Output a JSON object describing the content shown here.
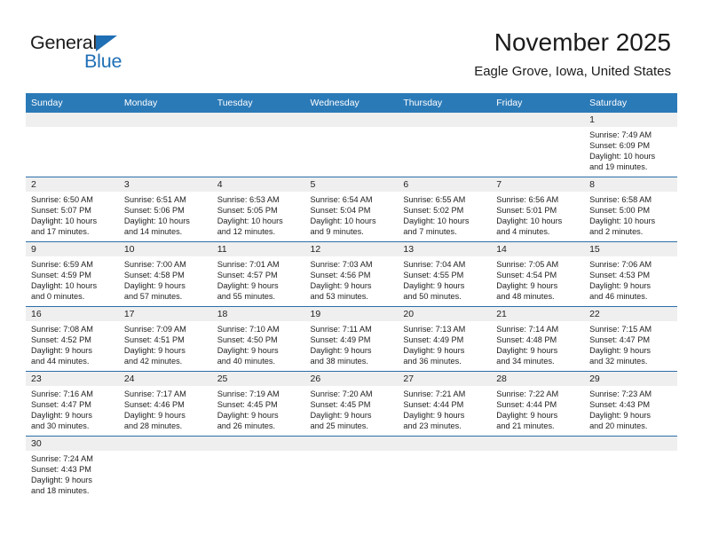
{
  "brand": {
    "name_part1": "General",
    "name_part2": "Blue",
    "accent_color": "#1f6fb5",
    "triangle_icon": "brand-triangle-icon"
  },
  "header": {
    "title": "November 2025",
    "subtitle": "Eagle Grove, Iowa, United States"
  },
  "theme": {
    "header_row_bg": "#2b7ab8",
    "daynum_band_bg": "#efefef",
    "row_divider": "#2b6ea8",
    "text": "#222222"
  },
  "columns": [
    "Sunday",
    "Monday",
    "Tuesday",
    "Wednesday",
    "Thursday",
    "Friday",
    "Saturday"
  ],
  "labels": {
    "sunrise": "Sunrise:",
    "sunset": "Sunset:",
    "daylight": "Daylight:"
  },
  "weeks": [
    [
      {
        "empty": true
      },
      {
        "empty": true
      },
      {
        "empty": true
      },
      {
        "empty": true
      },
      {
        "empty": true
      },
      {
        "empty": true
      },
      {
        "day": "1",
        "sunrise": "Sunrise: 7:49 AM",
        "sunset": "Sunset: 6:09 PM",
        "daylight_1": "Daylight: 10 hours",
        "daylight_2": "and 19 minutes."
      }
    ],
    [
      {
        "day": "2",
        "sunrise": "Sunrise: 6:50 AM",
        "sunset": "Sunset: 5:07 PM",
        "daylight_1": "Daylight: 10 hours",
        "daylight_2": "and 17 minutes."
      },
      {
        "day": "3",
        "sunrise": "Sunrise: 6:51 AM",
        "sunset": "Sunset: 5:06 PM",
        "daylight_1": "Daylight: 10 hours",
        "daylight_2": "and 14 minutes."
      },
      {
        "day": "4",
        "sunrise": "Sunrise: 6:53 AM",
        "sunset": "Sunset: 5:05 PM",
        "daylight_1": "Daylight: 10 hours",
        "daylight_2": "and 12 minutes."
      },
      {
        "day": "5",
        "sunrise": "Sunrise: 6:54 AM",
        "sunset": "Sunset: 5:04 PM",
        "daylight_1": "Daylight: 10 hours",
        "daylight_2": "and 9 minutes."
      },
      {
        "day": "6",
        "sunrise": "Sunrise: 6:55 AM",
        "sunset": "Sunset: 5:02 PM",
        "daylight_1": "Daylight: 10 hours",
        "daylight_2": "and 7 minutes."
      },
      {
        "day": "7",
        "sunrise": "Sunrise: 6:56 AM",
        "sunset": "Sunset: 5:01 PM",
        "daylight_1": "Daylight: 10 hours",
        "daylight_2": "and 4 minutes."
      },
      {
        "day": "8",
        "sunrise": "Sunrise: 6:58 AM",
        "sunset": "Sunset: 5:00 PM",
        "daylight_1": "Daylight: 10 hours",
        "daylight_2": "and 2 minutes."
      }
    ],
    [
      {
        "day": "9",
        "sunrise": "Sunrise: 6:59 AM",
        "sunset": "Sunset: 4:59 PM",
        "daylight_1": "Daylight: 10 hours",
        "daylight_2": "and 0 minutes."
      },
      {
        "day": "10",
        "sunrise": "Sunrise: 7:00 AM",
        "sunset": "Sunset: 4:58 PM",
        "daylight_1": "Daylight: 9 hours",
        "daylight_2": "and 57 minutes."
      },
      {
        "day": "11",
        "sunrise": "Sunrise: 7:01 AM",
        "sunset": "Sunset: 4:57 PM",
        "daylight_1": "Daylight: 9 hours",
        "daylight_2": "and 55 minutes."
      },
      {
        "day": "12",
        "sunrise": "Sunrise: 7:03 AM",
        "sunset": "Sunset: 4:56 PM",
        "daylight_1": "Daylight: 9 hours",
        "daylight_2": "and 53 minutes."
      },
      {
        "day": "13",
        "sunrise": "Sunrise: 7:04 AM",
        "sunset": "Sunset: 4:55 PM",
        "daylight_1": "Daylight: 9 hours",
        "daylight_2": "and 50 minutes."
      },
      {
        "day": "14",
        "sunrise": "Sunrise: 7:05 AM",
        "sunset": "Sunset: 4:54 PM",
        "daylight_1": "Daylight: 9 hours",
        "daylight_2": "and 48 minutes."
      },
      {
        "day": "15",
        "sunrise": "Sunrise: 7:06 AM",
        "sunset": "Sunset: 4:53 PM",
        "daylight_1": "Daylight: 9 hours",
        "daylight_2": "and 46 minutes."
      }
    ],
    [
      {
        "day": "16",
        "sunrise": "Sunrise: 7:08 AM",
        "sunset": "Sunset: 4:52 PM",
        "daylight_1": "Daylight: 9 hours",
        "daylight_2": "and 44 minutes."
      },
      {
        "day": "17",
        "sunrise": "Sunrise: 7:09 AM",
        "sunset": "Sunset: 4:51 PM",
        "daylight_1": "Daylight: 9 hours",
        "daylight_2": "and 42 minutes."
      },
      {
        "day": "18",
        "sunrise": "Sunrise: 7:10 AM",
        "sunset": "Sunset: 4:50 PM",
        "daylight_1": "Daylight: 9 hours",
        "daylight_2": "and 40 minutes."
      },
      {
        "day": "19",
        "sunrise": "Sunrise: 7:11 AM",
        "sunset": "Sunset: 4:49 PM",
        "daylight_1": "Daylight: 9 hours",
        "daylight_2": "and 38 minutes."
      },
      {
        "day": "20",
        "sunrise": "Sunrise: 7:13 AM",
        "sunset": "Sunset: 4:49 PM",
        "daylight_1": "Daylight: 9 hours",
        "daylight_2": "and 36 minutes."
      },
      {
        "day": "21",
        "sunrise": "Sunrise: 7:14 AM",
        "sunset": "Sunset: 4:48 PM",
        "daylight_1": "Daylight: 9 hours",
        "daylight_2": "and 34 minutes."
      },
      {
        "day": "22",
        "sunrise": "Sunrise: 7:15 AM",
        "sunset": "Sunset: 4:47 PM",
        "daylight_1": "Daylight: 9 hours",
        "daylight_2": "and 32 minutes."
      }
    ],
    [
      {
        "day": "23",
        "sunrise": "Sunrise: 7:16 AM",
        "sunset": "Sunset: 4:47 PM",
        "daylight_1": "Daylight: 9 hours",
        "daylight_2": "and 30 minutes."
      },
      {
        "day": "24",
        "sunrise": "Sunrise: 7:17 AM",
        "sunset": "Sunset: 4:46 PM",
        "daylight_1": "Daylight: 9 hours",
        "daylight_2": "and 28 minutes."
      },
      {
        "day": "25",
        "sunrise": "Sunrise: 7:19 AM",
        "sunset": "Sunset: 4:45 PM",
        "daylight_1": "Daylight: 9 hours",
        "daylight_2": "and 26 minutes."
      },
      {
        "day": "26",
        "sunrise": "Sunrise: 7:20 AM",
        "sunset": "Sunset: 4:45 PM",
        "daylight_1": "Daylight: 9 hours",
        "daylight_2": "and 25 minutes."
      },
      {
        "day": "27",
        "sunrise": "Sunrise: 7:21 AM",
        "sunset": "Sunset: 4:44 PM",
        "daylight_1": "Daylight: 9 hours",
        "daylight_2": "and 23 minutes."
      },
      {
        "day": "28",
        "sunrise": "Sunrise: 7:22 AM",
        "sunset": "Sunset: 4:44 PM",
        "daylight_1": "Daylight: 9 hours",
        "daylight_2": "and 21 minutes."
      },
      {
        "day": "29",
        "sunrise": "Sunrise: 7:23 AM",
        "sunset": "Sunset: 4:43 PM",
        "daylight_1": "Daylight: 9 hours",
        "daylight_2": "and 20 minutes."
      }
    ],
    [
      {
        "day": "30",
        "sunrise": "Sunrise: 7:24 AM",
        "sunset": "Sunset: 4:43 PM",
        "daylight_1": "Daylight: 9 hours",
        "daylight_2": "and 18 minutes."
      },
      {
        "empty": true
      },
      {
        "empty": true
      },
      {
        "empty": true
      },
      {
        "empty": true
      },
      {
        "empty": true
      },
      {
        "empty": true
      }
    ]
  ]
}
